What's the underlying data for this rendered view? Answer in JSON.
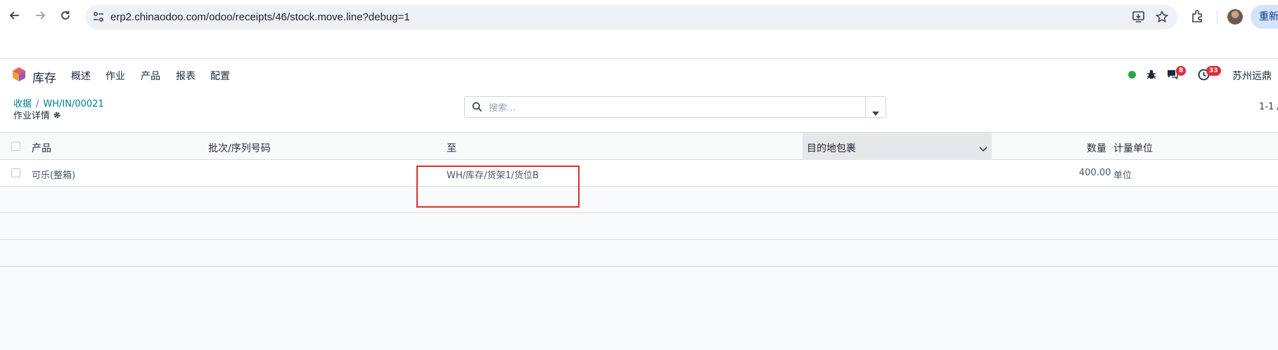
{
  "browser": {
    "url": "erp2.chinaodoo.com/odoo/receipts/46/stock.move.line?debug=1",
    "relaunch_label": "重新启"
  },
  "navbar": {
    "app_name": "库存",
    "menu": [
      "概述",
      "作业",
      "产品",
      "报表",
      "配置"
    ],
    "messages_count": "8",
    "activities_count": "33",
    "company": "苏州远鼎"
  },
  "control": {
    "breadcrumb_parent": "收据",
    "breadcrumb_sep": "/",
    "breadcrumb_current": "WH/IN/00021",
    "subtitle": "作业详情",
    "search_placeholder": "搜索...",
    "pager": "1-1 /"
  },
  "list": {
    "columns": {
      "product": "产品",
      "lot": "批次/序列号码",
      "to": "至",
      "dest_package": "目的地包裹",
      "quantity": "数量",
      "uom": "计量单位"
    },
    "rows": [
      {
        "product": "可乐(整箱)",
        "lot": "",
        "to": "WH/库存/货架1/货位B",
        "dest_package": "",
        "quantity": "400.00",
        "uom": "单位"
      }
    ]
  },
  "colors": {
    "accent": "#017e84",
    "highlight_box": "#d93025",
    "badge": "#e02c3a",
    "online": "#28a745"
  }
}
